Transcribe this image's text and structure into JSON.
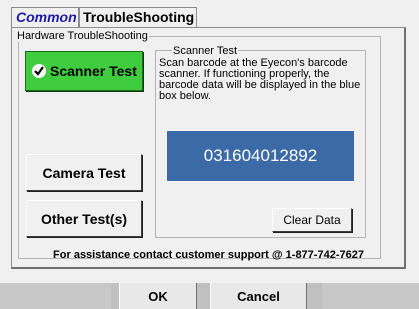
{
  "tabs": [
    {
      "label": "Common"
    },
    {
      "label": "TroubleShooting"
    }
  ],
  "hardware_group": {
    "legend": "Hardware TroubleShooting"
  },
  "buttons": {
    "scanner_test": "Scanner Test",
    "camera_test": "Camera Test",
    "other_tests": "Other Test(s)",
    "clear_data": "Clear Data"
  },
  "scanner_panel": {
    "legend": "Scanner Test",
    "description": "Scan barcode at the Eyecon's barcode scanner. If functioning properly, the barcode data will be displayed in the blue box below.",
    "barcode_value": "031604012892"
  },
  "support_text": "For assistance contact customer support @ 1-877-742-7627",
  "dialog_buttons": {
    "ok": "OK",
    "cancel": "Cancel"
  },
  "colors": {
    "scanner_button_active": "#3fcc3f",
    "barcode_box": "#3b6aa6",
    "common_tab_text": "#1a1aa8"
  }
}
